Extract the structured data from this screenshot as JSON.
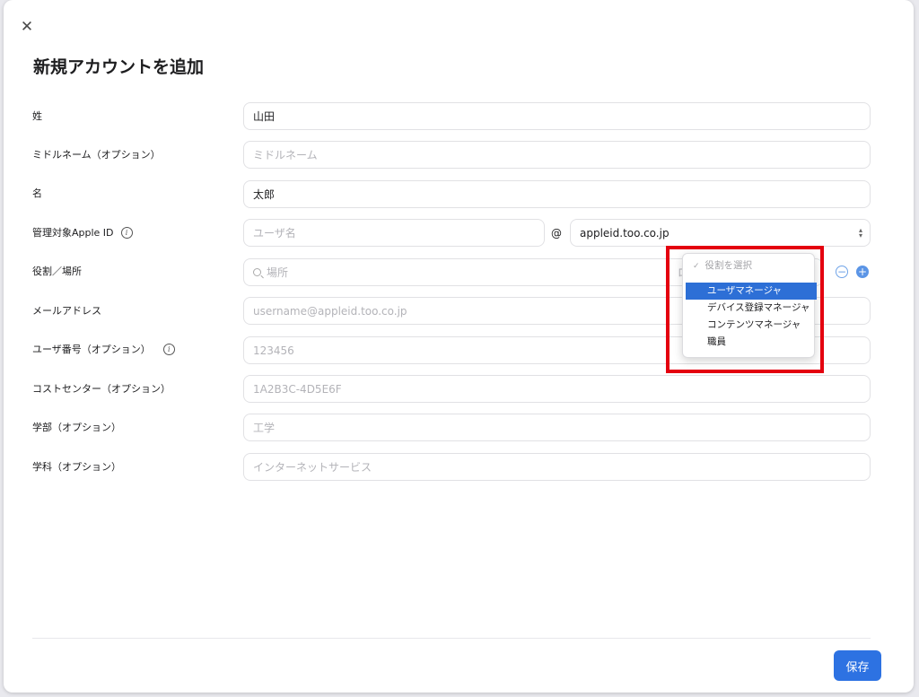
{
  "dialog": {
    "close_icon": "close-icon",
    "title": "新規アカウントを追加"
  },
  "labels": {
    "last_name": "姓",
    "middle_name": "ミドルネーム（オプション）",
    "first_name": "名",
    "managed_apple_id": "管理対象Apple ID",
    "role_location": "役割／場所",
    "email": "メールアドレス",
    "user_number": "ユーザ番号（オプション）",
    "cost_center": "コストセンター（オプション）",
    "department": "学部（オプション）",
    "course": "学科（オプション）"
  },
  "fields": {
    "last_name_value": "山田",
    "middle_name_placeholder": "ミドルネーム",
    "first_name_value": "太郎",
    "username_placeholder": "ユーザ名",
    "at_sign": "@",
    "domain_value": "appleid.too.co.jp",
    "location_placeholder": "場所",
    "role_partial": "ロ",
    "email_placeholder": "username@appleid.too.co.jp",
    "user_number_placeholder": "123456",
    "cost_center_placeholder": "1A2B3C-4D5E6F",
    "department_placeholder": "工学",
    "course_placeholder": "インターネットサービス"
  },
  "role_dropdown": {
    "header": "役割を選択",
    "options": [
      "ユーザマネージャ",
      "デバイス登録マネージャ",
      "コンテンツマネージャ",
      "職員"
    ],
    "selected_index": 0
  },
  "colors": {
    "accent": "#2d72e2",
    "highlight": "#e4000f",
    "selected_bg": "#2d6fd6"
  },
  "footer": {
    "save_label": "保存"
  }
}
